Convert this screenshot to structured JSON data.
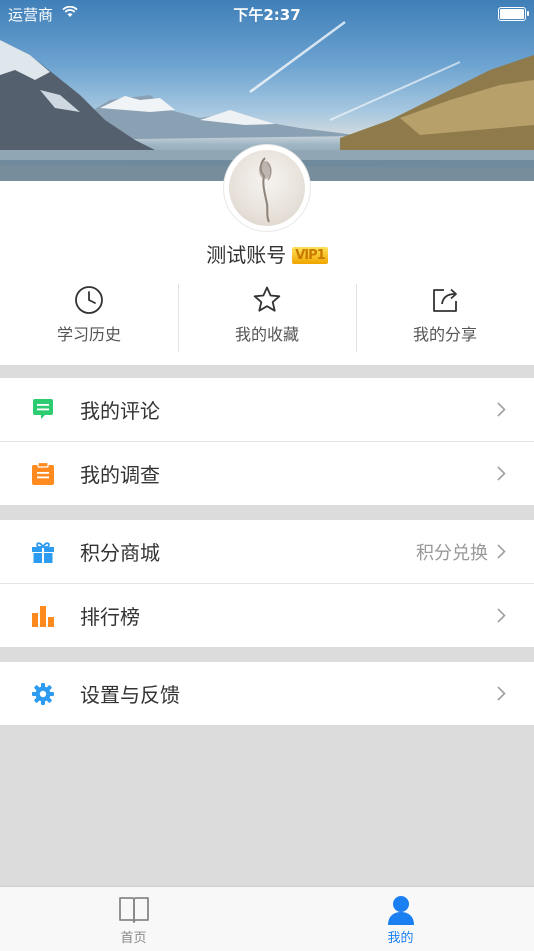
{
  "status_bar": {
    "carrier": "运营商",
    "time": "下午2:37",
    "battery_level": 1.0
  },
  "profile": {
    "username": "测试账号",
    "vip_badge": "VIP1"
  },
  "quick_actions": [
    {
      "label": "学习历史",
      "icon": "clock-icon"
    },
    {
      "label": "我的收藏",
      "icon": "star-icon"
    },
    {
      "label": "我的分享",
      "icon": "share-icon"
    }
  ],
  "menu": {
    "comments": {
      "label": "我的评论",
      "icon": "comment-icon",
      "color": "#2ecc71"
    },
    "surveys": {
      "label": "我的调查",
      "icon": "clipboard-icon",
      "color": "#ff8a1f"
    },
    "points_mall": {
      "label": "积分商城",
      "extra": "积分兑换",
      "icon": "gift-icon",
      "color": "#2d9cf0"
    },
    "leaderboard": {
      "label": "排行榜",
      "icon": "bar-chart-icon",
      "color": "#ff8a1f"
    },
    "settings": {
      "label": "设置与反馈",
      "icon": "gear-icon",
      "color": "#2d9cf0"
    }
  },
  "tab_bar": {
    "home": {
      "label": "首页",
      "icon": "book-icon",
      "color": "#888888"
    },
    "mine": {
      "label": "我的",
      "icon": "person-icon",
      "color": "#1a7ff0",
      "active": true
    }
  }
}
